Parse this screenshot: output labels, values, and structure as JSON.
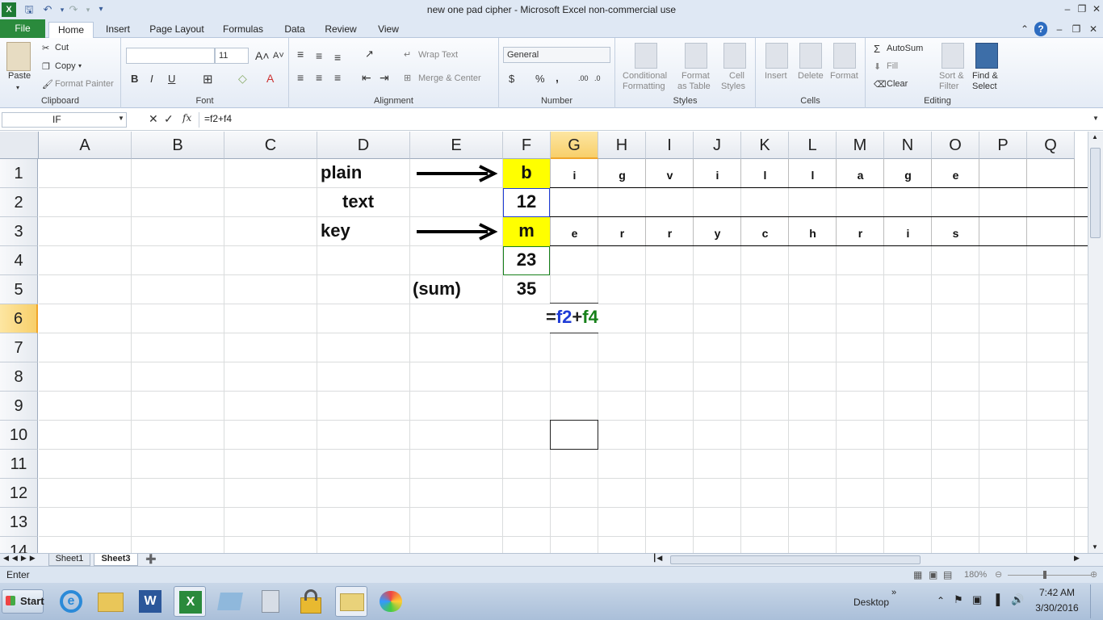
{
  "window": {
    "title": "new one pad cipher  -  Microsoft Excel non-commercial use"
  },
  "tabs": [
    "File",
    "Home",
    "Insert",
    "Page Layout",
    "Formulas",
    "Data",
    "Review",
    "View"
  ],
  "active_tab": "Home",
  "ribbon": {
    "clipboard": {
      "paste": "Paste",
      "cut": "Cut",
      "copy": "Copy",
      "format_painter": "Format Painter",
      "label": "Clipboard"
    },
    "font": {
      "size": "11",
      "bold": "B",
      "italic": "I",
      "underline": "U",
      "label": "Font"
    },
    "alignment": {
      "wrap": "Wrap Text",
      "merge": "Merge & Center",
      "label": "Alignment"
    },
    "number": {
      "format": "General",
      "dollar": "$",
      "percent": "%",
      "comma": ",",
      "label": "Number"
    },
    "styles": {
      "conditional": "Conditional",
      "formatting": "Formatting",
      "format_as": "Format",
      "as_table": "as Table",
      "cell": "Cell",
      "cell_styles": "Styles",
      "label": "Styles"
    },
    "cells": {
      "insert": "Insert",
      "delete": "Delete",
      "format": "Format",
      "label": "Cells"
    },
    "editing": {
      "autosum": "AutoSum",
      "fill": "Fill",
      "clear": "Clear",
      "sort": "Sort &",
      "filter": "Filter",
      "find": "Find &",
      "select": "Select",
      "label": "Editing"
    }
  },
  "formula_bar": {
    "name_box": "IF",
    "fx": "fx",
    "formula": "=f2+f4"
  },
  "columns": [
    "A",
    "B",
    "C",
    "D",
    "E",
    "F",
    "G",
    "H",
    "I",
    "J",
    "K",
    "L",
    "M",
    "N",
    "O",
    "P",
    "Q"
  ],
  "rows": [
    "1",
    "2",
    "3",
    "4",
    "5",
    "6",
    "7",
    "8",
    "9",
    "10",
    "11",
    "12",
    "13",
    "14"
  ],
  "cells": {
    "D1": "plain",
    "D2": "text",
    "D3": "key",
    "E5": "(sum)",
    "F1": "b",
    "F2": "12",
    "F3": "m",
    "F4": "23",
    "F5": "35",
    "row1_letters": [
      "i",
      "g",
      "v",
      "i",
      "l",
      "l",
      "a",
      "g",
      "e"
    ],
    "row3_letters": [
      "e",
      "r",
      "r",
      "y",
      "c",
      "h",
      "r",
      "i",
      "s"
    ]
  },
  "edit_cell": {
    "eq": "=",
    "ref1": "f2",
    "plus": "+",
    "ref2": "f4"
  },
  "sheets": [
    "Sheet1",
    "Sheet3"
  ],
  "active_sheet": "Sheet3",
  "status": {
    "mode": "Enter",
    "zoom": "180%"
  },
  "taskbar": {
    "start": "Start",
    "desktop": "Desktop",
    "time": "7:42 AM",
    "date": "3/30/2016"
  },
  "colors": {
    "yellow": "#ffff00",
    "ref_blue": "#1f3cd6",
    "ref_green": "#17801a",
    "excel_green": "#2a8a3c"
  }
}
